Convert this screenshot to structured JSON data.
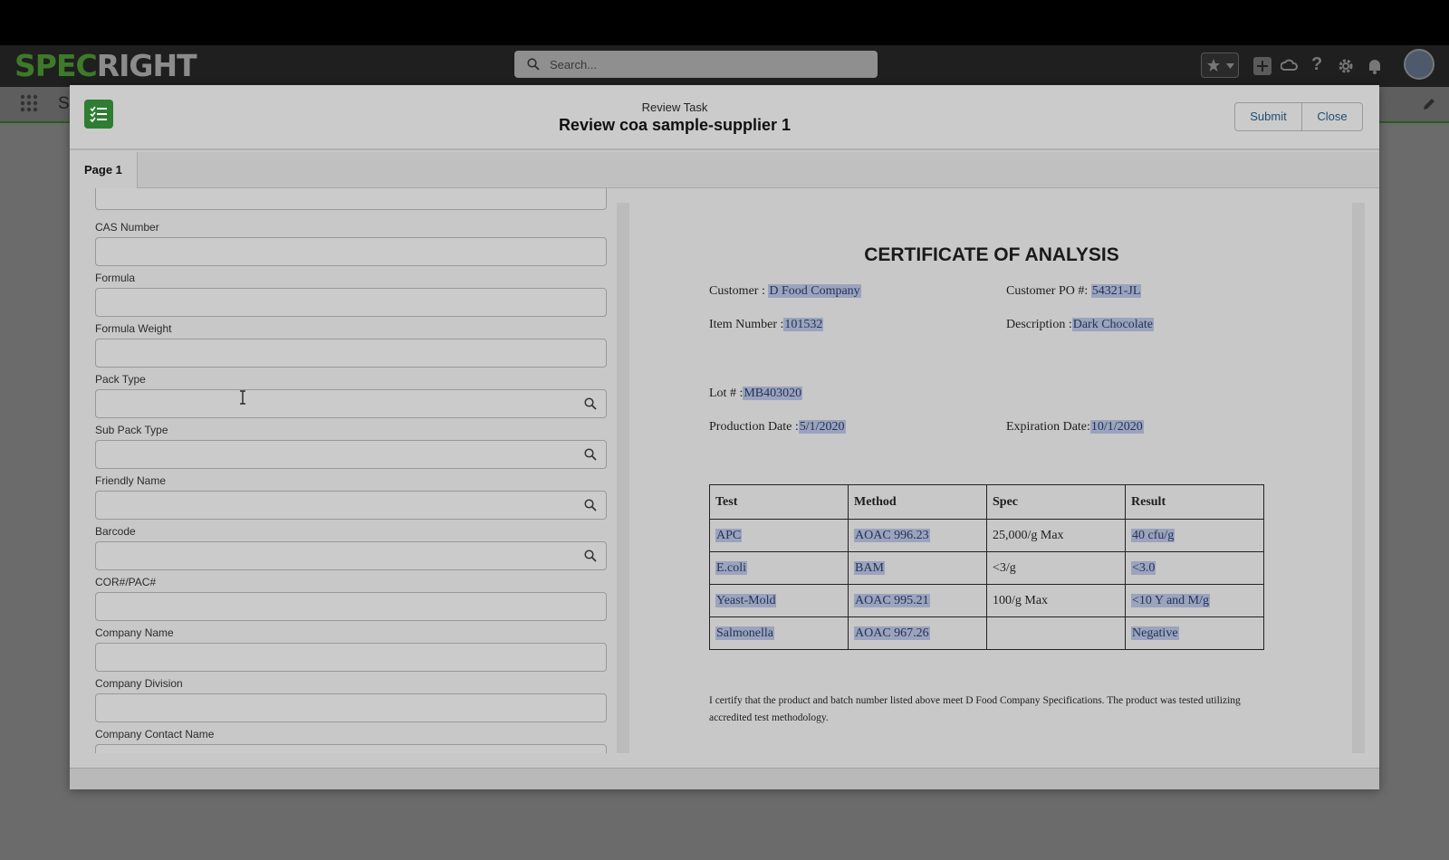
{
  "header": {
    "logo_part1": "SPEC",
    "logo_part2": "RIGHT",
    "search_placeholder": "Search...",
    "subnav_text": "S",
    "icons": [
      "star-icon",
      "chevron-down-icon",
      "add-icon",
      "cloud-icon",
      "help-icon",
      "gear-icon",
      "bell-icon",
      "avatar"
    ]
  },
  "modal": {
    "subtitle": "Review Task",
    "title": "Review coa sample-supplier 1",
    "submit_label": "Submit",
    "close_label": "Close",
    "tab_label": "Page 1"
  },
  "form": {
    "fields": [
      {
        "label": "CAS Number",
        "value": "",
        "lookup": false
      },
      {
        "label": "Formula",
        "value": "",
        "lookup": false
      },
      {
        "label": "Formula Weight",
        "value": "",
        "lookup": false
      },
      {
        "label": "Pack Type",
        "value": "",
        "lookup": true
      },
      {
        "label": "Sub Pack Type",
        "value": "",
        "lookup": true
      },
      {
        "label": "Friendly Name",
        "value": "",
        "lookup": true
      },
      {
        "label": "Barcode",
        "value": "",
        "lookup": true
      },
      {
        "label": "COR#/PAC#",
        "value": "",
        "lookup": false
      },
      {
        "label": "Company Name",
        "value": "",
        "lookup": false
      },
      {
        "label": "Company Division",
        "value": "",
        "lookup": false
      },
      {
        "label": "Company Contact Name",
        "value": "",
        "lookup": false
      }
    ]
  },
  "document": {
    "title": "CERTIFICATE OF ANALYSIS",
    "customer_label": "Customer :",
    "customer_value": "D Food Company",
    "po_label": "Customer PO #:",
    "po_value": "54321-JL",
    "item_label": "Item Number :",
    "item_value": "101532",
    "desc_label": "Description :",
    "desc_value": "Dark Chocolate",
    "lot_label": "Lot # :",
    "lot_value": "MB403020",
    "prod_label": "Production Date :",
    "prod_value": "5/1/2020",
    "exp_label": "Expiration Date:",
    "exp_value": "10/1/2020",
    "table": {
      "headers": [
        "Test",
        "Method",
        "Spec",
        "Result"
      ],
      "rows": [
        [
          "APC",
          "AOAC 996.23",
          "25,000/g Max",
          "40 cfu/g"
        ],
        [
          "E.coli",
          "BAM",
          "<3/g",
          "<3.0"
        ],
        [
          "Yeast-Mold",
          "AOAC 995.21",
          "100/g Max",
          "<10 Y and M/g"
        ],
        [
          "Salmonella",
          "AOAC 967.26",
          "",
          "Negative"
        ]
      ]
    },
    "certification": "I certify that the product and batch number listed above meet D Food Company Specifications. The product was tested utilizing accredited test methodology."
  },
  "colors": {
    "brand_green": "#3d7a2a",
    "highlight": "#9aa4bd",
    "button_text": "#1e4e73"
  }
}
